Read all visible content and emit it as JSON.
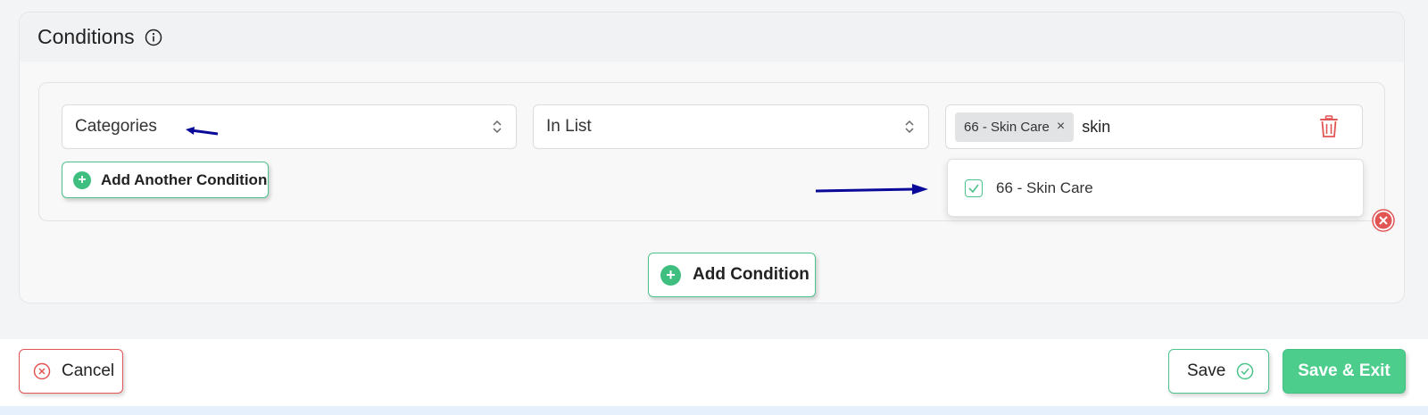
{
  "conditions_panel": {
    "title": "Conditions",
    "condition": {
      "attribute": "Categories",
      "operator": "In List",
      "selected_chip": "66 - Skin Care",
      "search_text": "skin"
    },
    "dropdown_option": "66 - Skin Care",
    "add_another_label": "Add Another Condition",
    "add_condition_label": "Add Condition"
  },
  "footer": {
    "cancel_label": "Cancel",
    "save_label": "Save",
    "save_exit_label": "Save & Exit"
  },
  "colors": {
    "accent_green": "#4ccd8c",
    "danger_red": "#e25555",
    "annotation_arrow": "#0a0a9a"
  },
  "icons": [
    "info-icon",
    "chevron-updown-icon",
    "close-icon",
    "trash-icon",
    "plus-circle-icon",
    "checkbox-checked-icon",
    "remove-circle-icon",
    "cancel-circle-icon",
    "check-circle-icon"
  ]
}
